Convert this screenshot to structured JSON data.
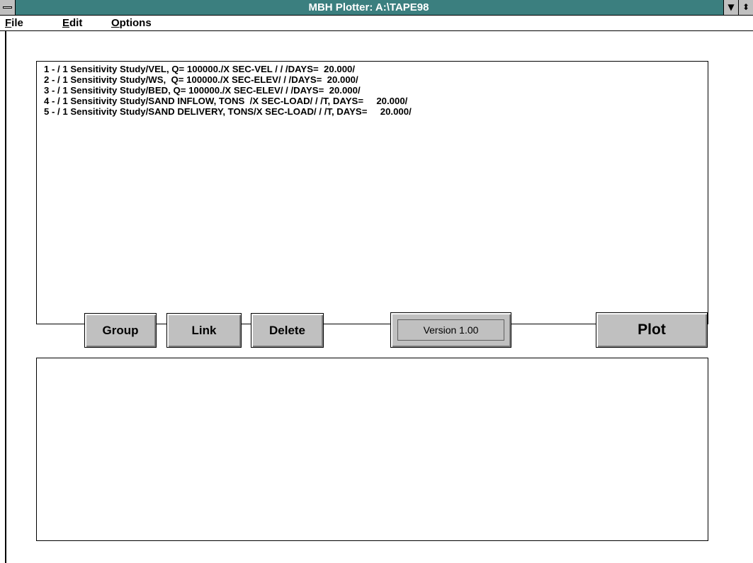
{
  "window": {
    "title": "MBH Plotter: A:\\TAPE98"
  },
  "titlebar_buttons": {
    "minimize_glyph": "▼",
    "restore_glyph": "⬍"
  },
  "menu": {
    "items": [
      {
        "accel": "F",
        "rest": "ile"
      },
      {
        "accel": "E",
        "rest": "dit"
      },
      {
        "accel": "O",
        "rest": "ptions"
      }
    ]
  },
  "records": [
    "1 - / 1 Sensitivity Study/VEL, Q= 100000./X SEC-VEL / / /DAYS=  20.000/",
    "2 - / 1 Sensitivity Study/WS,  Q= 100000./X SEC-ELEV/ / /DAYS=  20.000/",
    "3 - / 1 Sensitivity Study/BED, Q= 100000./X SEC-ELEV/ / /DAYS=  20.000/",
    "4 - / 1 Sensitivity Study/SAND INFLOW, TONS  /X SEC-LOAD/ / /T, DAYS=     20.000/",
    "5 - / 1 Sensitivity Study/SAND DELIVERY, TONS/X SEC-LOAD/ / /T, DAYS=     20.000/"
  ],
  "buttons": {
    "group": "Group",
    "link": "Link",
    "delete": "Delete",
    "plot": "Plot"
  },
  "version": "Version 1.00",
  "colors": {
    "titlebar": "#3b7f7f",
    "button_face": "#c0c0c0"
  }
}
